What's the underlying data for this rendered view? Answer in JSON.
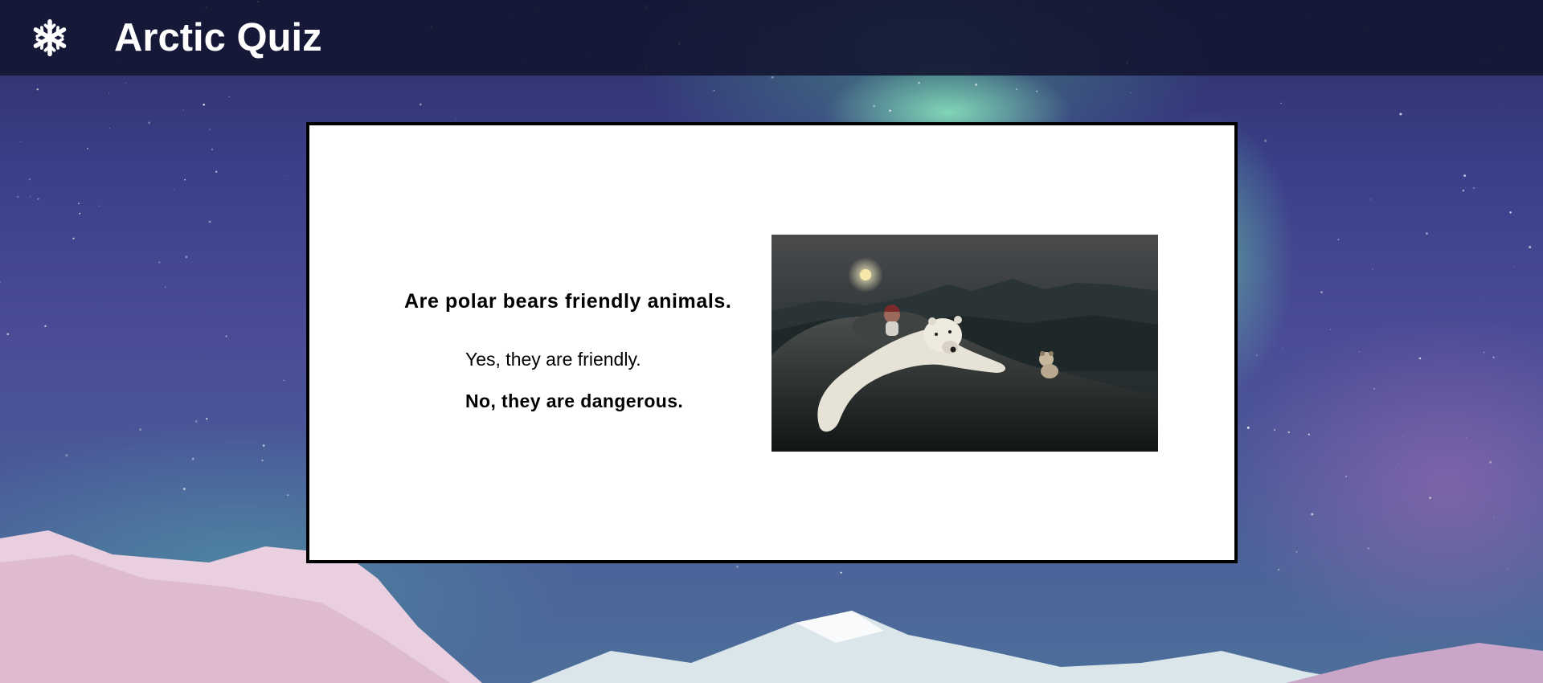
{
  "header": {
    "logo_icon": "snowflake-icon",
    "title": "Arctic Quiz",
    "background_color": "#12142f"
  },
  "quiz": {
    "question": "Are polar bears friendly animals.",
    "answers": [
      {
        "label": "Yes, they are friendly."
      },
      {
        "label": "No, they are dangerous."
      }
    ],
    "image_subject": "polar-bear-photo"
  },
  "background": {
    "scene": "aurora-night-sky-mountains"
  }
}
